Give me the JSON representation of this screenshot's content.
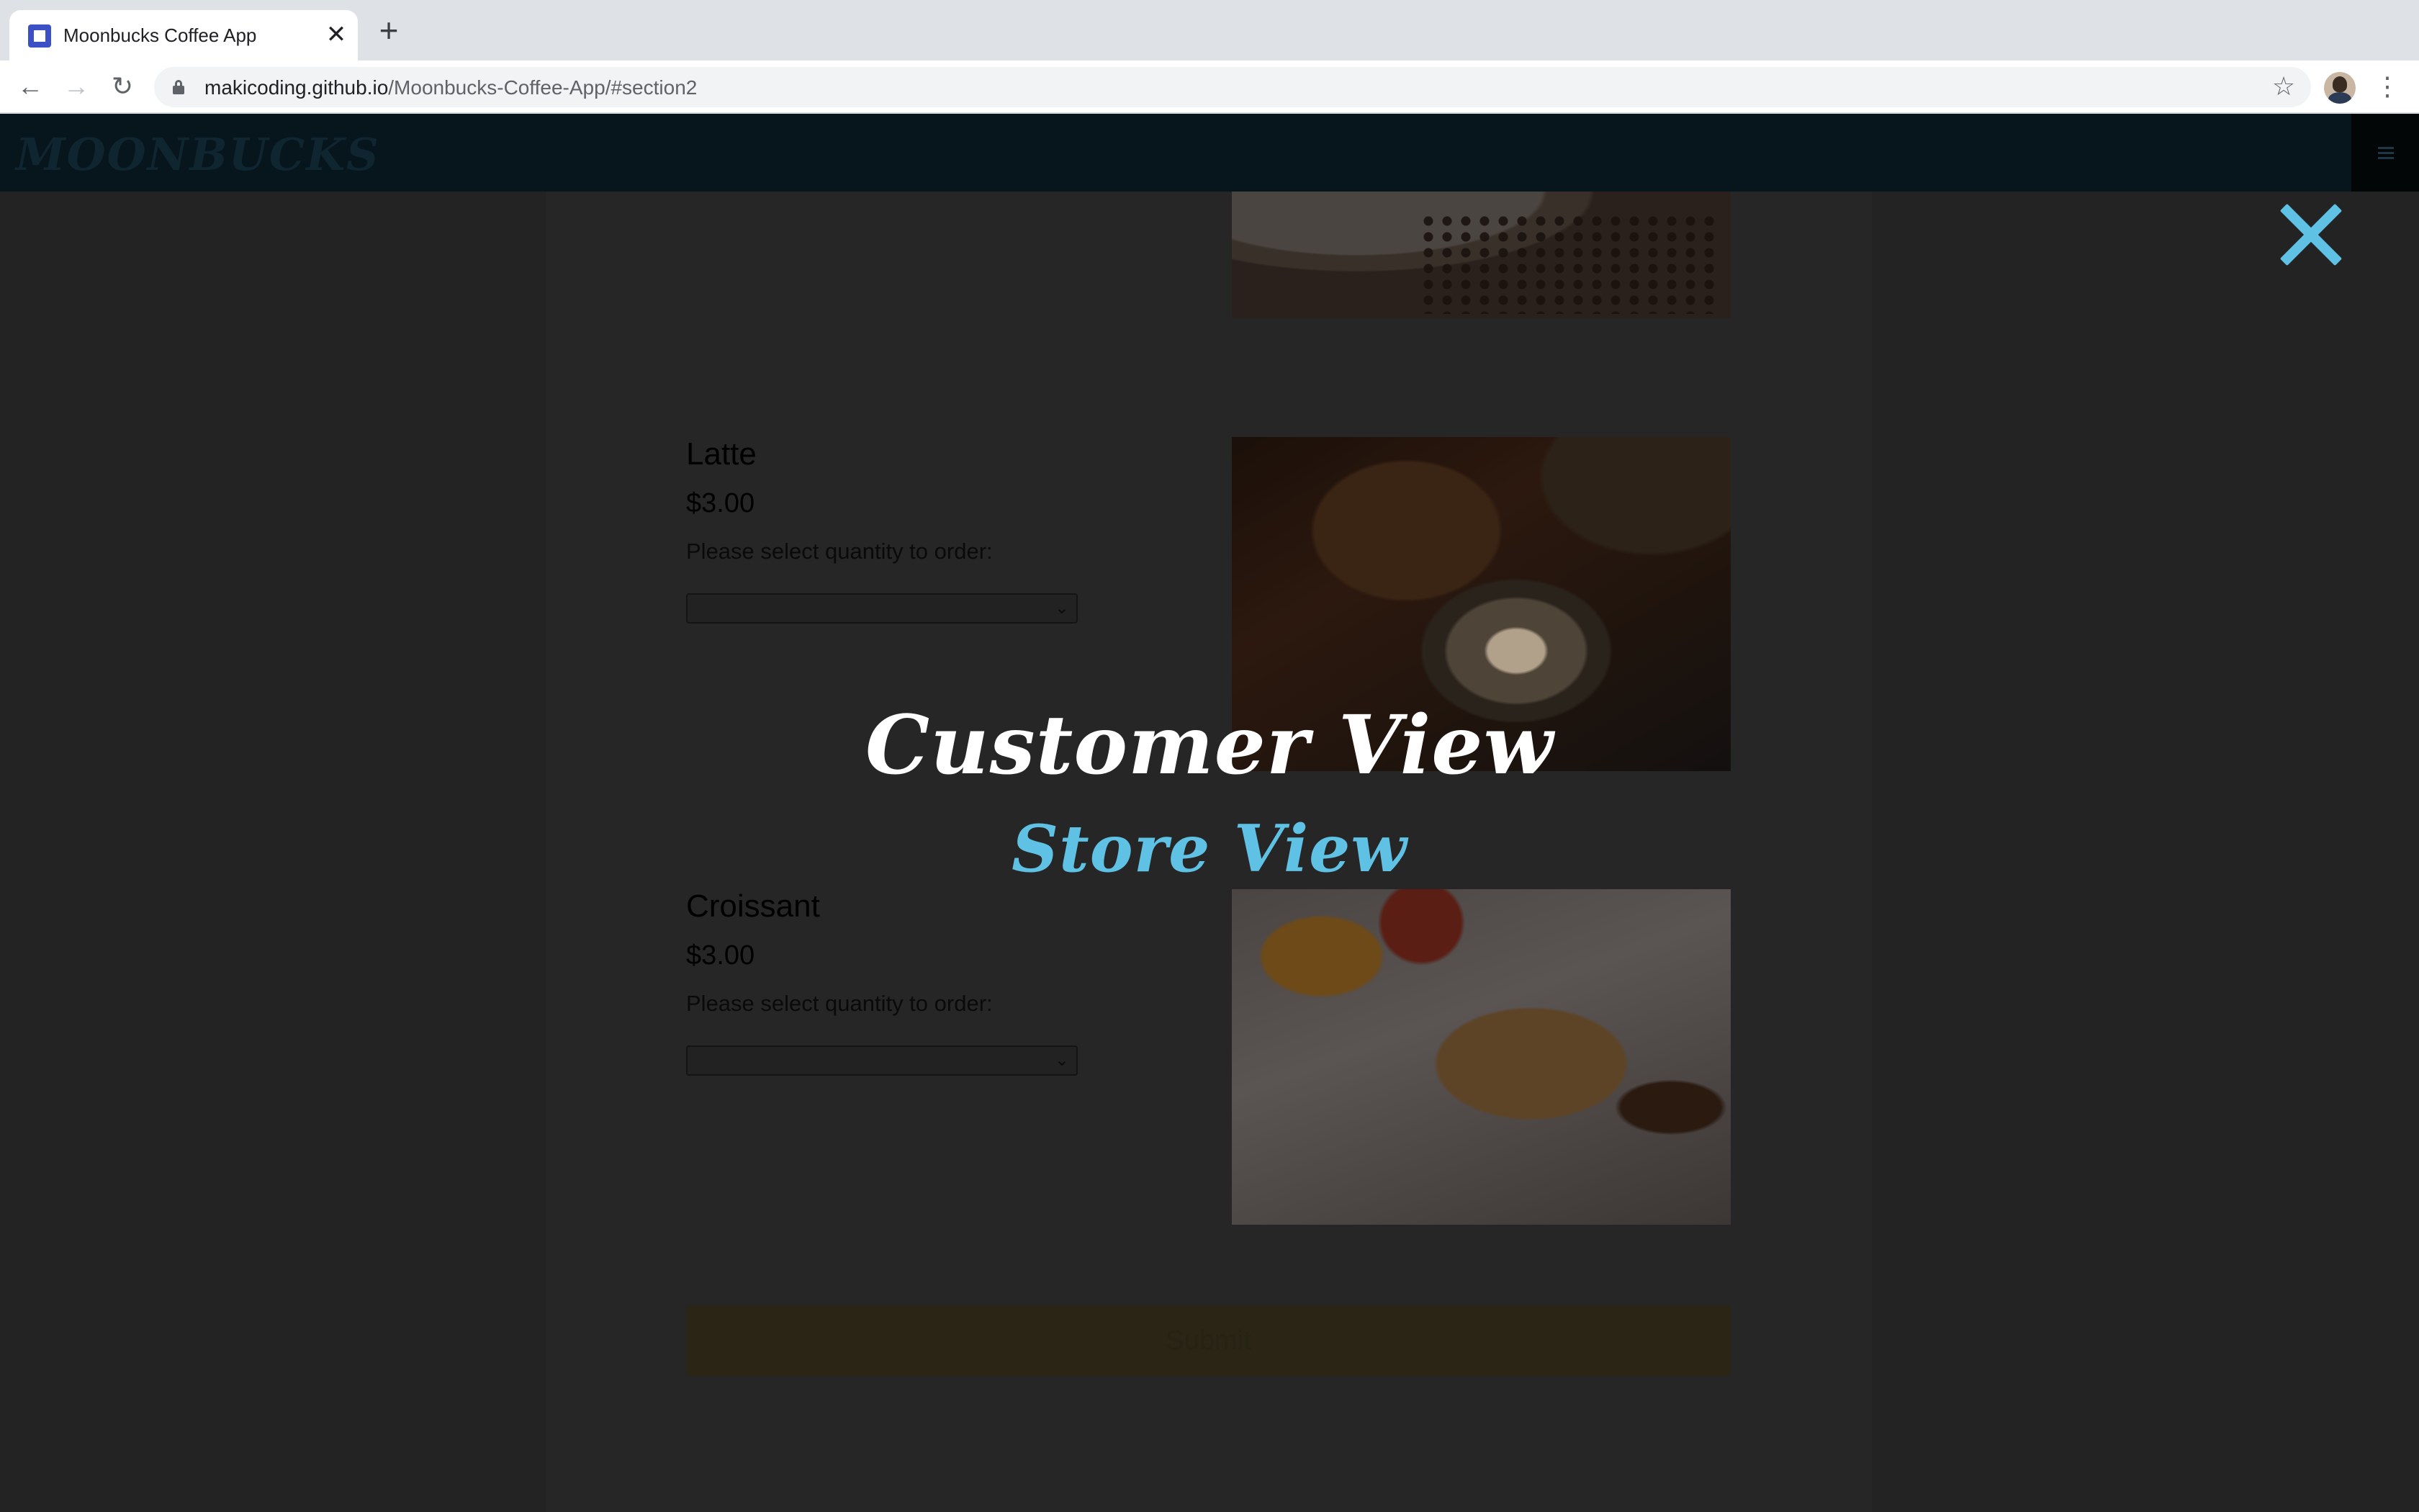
{
  "browser": {
    "tab_title": "Moonbucks Coffee App",
    "tab_close": "✕",
    "new_tab": "+",
    "url_host": "makicoding.github.io",
    "url_path": "/Moonbucks-Coffee-App/#section2",
    "back": "←",
    "forward": "→",
    "reload": "↻",
    "bookmark": "☆",
    "menu": "⋮"
  },
  "site": {
    "logo": "MOONBUCKS"
  },
  "menu_items": [
    {
      "name": "Latte",
      "price": "$3.00",
      "prompt": "Please select quantity to order:",
      "quantity": ""
    },
    {
      "name": "Croissant",
      "price": "$3.00",
      "prompt": "Please select quantity to order:",
      "quantity": ""
    }
  ],
  "submit_label": "Submit",
  "overlay": {
    "close": "✕",
    "links": [
      "Customer View",
      "Store View"
    ],
    "accent_color": "#5fc1e3"
  },
  "icons": {
    "favicon": "square-favicon-icon",
    "lock": "lock-icon",
    "star": "star-icon",
    "profile": "avatar",
    "hamburger": "hamburger-icon",
    "close": "close-icon",
    "dropdown": "chevron-down-icon"
  }
}
